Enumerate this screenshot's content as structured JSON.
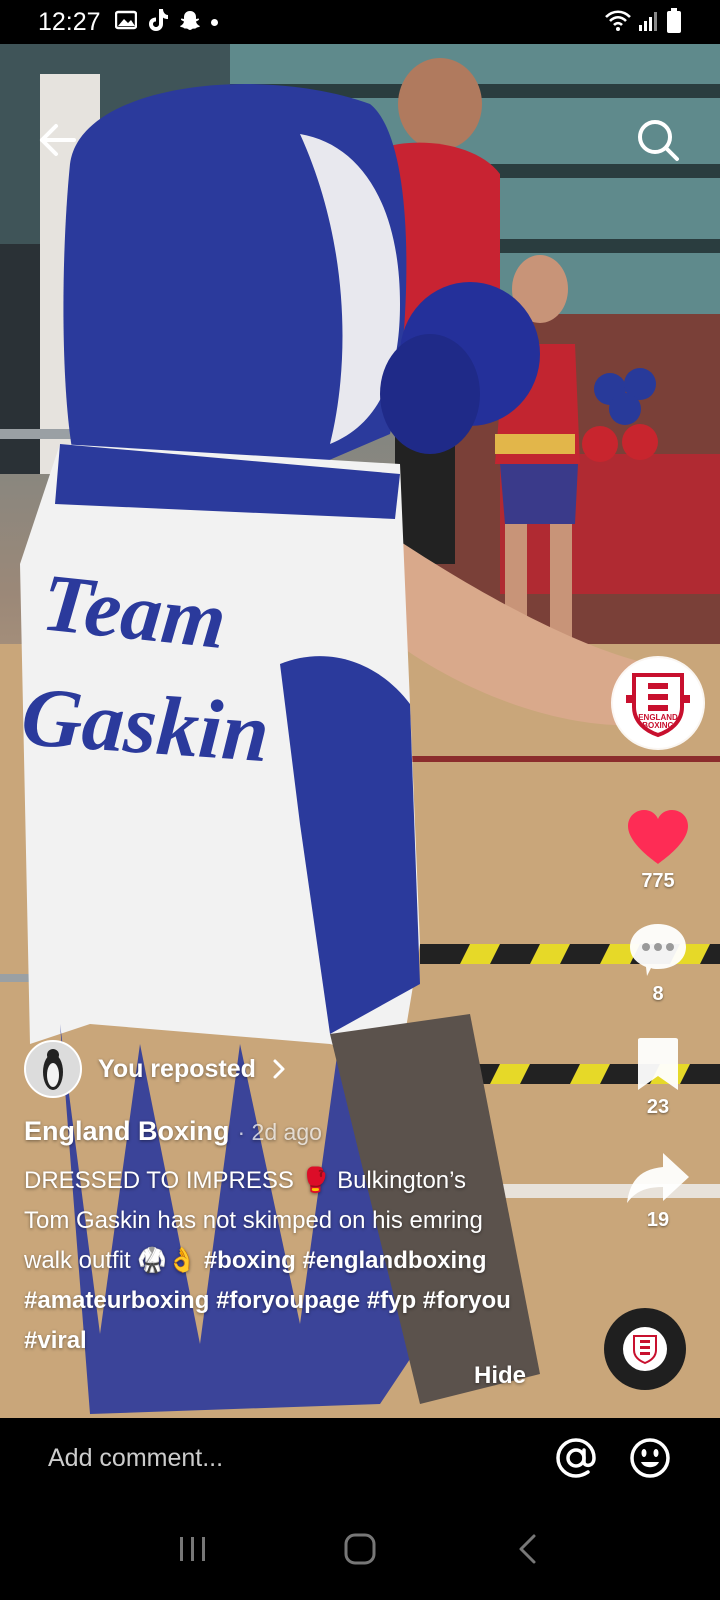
{
  "status_bar": {
    "time": "12:27",
    "left_icons": [
      "image-icon",
      "tiktok-icon",
      "snapchat-icon",
      "dot-icon"
    ],
    "right_icons": [
      "wifi-icon",
      "signal-icon",
      "battery-icon"
    ]
  },
  "video": {
    "jersey_text_line1": "Team",
    "jersey_text_line2": "Gaskin"
  },
  "actions": {
    "profile_badge_lines": [
      "ENGLAND",
      "BOXING"
    ],
    "likes": "775",
    "comments": "8",
    "saves": "23",
    "shares": "19"
  },
  "post": {
    "repost_label": "You reposted",
    "author": "England Boxing",
    "age": "· 2d ago",
    "caption_plain": "DRESSED TO IMPRESS 🥊 Bulkington’s Tom Gaskin has not skimped on his emring walk outfit 🥋👌 ",
    "hashtags": [
      "#boxing",
      "#englandboxing",
      "#amateurboxing",
      "#foryoupage",
      "#fyp",
      "#foryou",
      "#viral"
    ],
    "hide_label": "Hide"
  },
  "comment_bar": {
    "placeholder": "Add comment..."
  },
  "colors": {
    "like_red": "#fe2c55",
    "background": "#000000"
  }
}
